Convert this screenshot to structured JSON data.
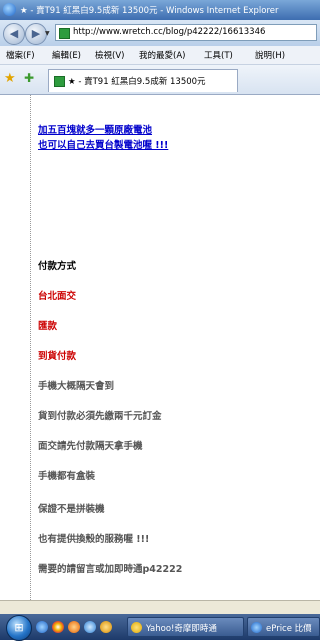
{
  "window": {
    "title": "★ - 賣T91 紅黑白9.5成新 13500元 - Windows Internet Explorer"
  },
  "nav": {
    "back_glyph": "◀",
    "forward_glyph": "▶",
    "url": "http://www.wretch.cc/blog/p42222/16613346"
  },
  "menu": {
    "items": [
      "檔案(F)",
      "編輯(E)",
      "檢視(V)",
      "我的最愛(A)",
      "工具(T)",
      "說明(H)"
    ]
  },
  "tabs": {
    "active_label": "★ - 賣T91 紅黑白9.5成新 13500元"
  },
  "content": {
    "link1": "加五百塊就多一顆原廠電池",
    "link2": "也可以自己去買台製電池喔 !!!",
    "payment_heading": "付款方式",
    "pay_option_1": "台北面交",
    "pay_option_2": "匯款",
    "pay_option_3": "到貨付款",
    "note_1": "手機大概隔天會到",
    "note_2": "貨到付款必須先繳兩千元訂金",
    "note_3": "面交請先付款隔天拿手機",
    "note_4": "手機都有盒裝",
    "note_5": "保證不是拼裝機",
    "note_6": "也有提供換殼的服務喔 !!!",
    "note_7": "需要的請留言或加即時通p42222"
  },
  "taskbar": {
    "start_glyph": "⊞",
    "task_1": "Yahoo!奇摩即時通",
    "task_2": "ePrice 比價"
  },
  "colors": {
    "link": "#0000cc",
    "heading": "#000000",
    "payment_option": "#cc0000",
    "note": "#555555"
  }
}
